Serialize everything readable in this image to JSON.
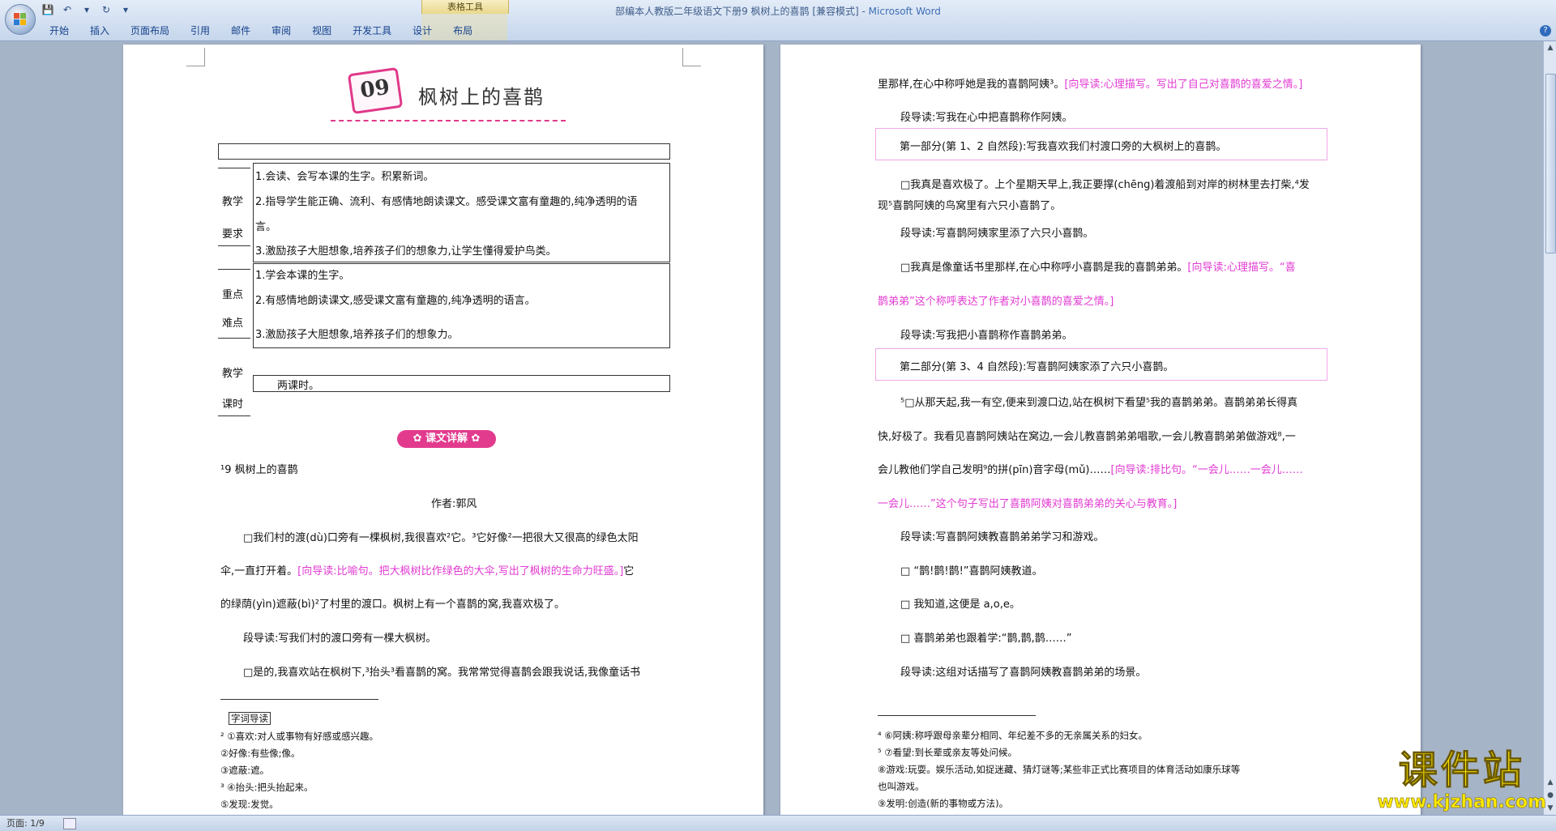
{
  "window": {
    "title": "部编本人教版二年级语文下册9 枫树上的喜鹊 [兼容模式] - ",
    "app_name": "Microsoft Word",
    "context_group": "表格工具"
  },
  "qat": {
    "save": "💾",
    "undo": "↶",
    "undo_drop": "▾",
    "redo": "↻",
    "customize": "▾"
  },
  "tabs": [
    "开始",
    "插入",
    "页面布局",
    "引用",
    "邮件",
    "审阅",
    "视图",
    "开发工具",
    "设计",
    "布局"
  ],
  "help": "?",
  "status": {
    "page": "页面: 1/9"
  },
  "left_page": {
    "badge": "09",
    "title": "枫树上的喜鹊",
    "table": {
      "req_label_1": "教学",
      "req_label_2": "要求",
      "req_1": "1.会读、会写本课的生字。积累新词。",
      "req_2a": "2.指导学生能正确、流利、有感情地朗读课文。感受课文富有童趣的,纯净透明的语",
      "req_2b": "言。",
      "req_3": "3.激励孩子大胆想象,培养孩子们的想象力,让学生懂得爱护鸟类。",
      "key_label_1": "重点",
      "key_label_2": "难点",
      "key_1": "1.学会本课的生字。",
      "key_2": "2.有感情地朗读课文,感受课文富有童趣的,纯净透明的语言。",
      "key_3": "3.激励孩子大胆想象,培养孩子们的想象力。",
      "time_label_1": "教学",
      "time_label_2": "课时",
      "time_value": "两课时。"
    },
    "section_banner": "✿ 课文详解 ✿",
    "text_title": "¹9 枫树上的喜鹊",
    "author": "作者:郭风",
    "p1a": "□我们村的渡(dù)口旁有一棵枫树,我很喜欢²它。³它好像²一把很大又很高的绿色太阳",
    "p1b_a": "伞,一直打开着。",
    "p1b_b": "[向导读:比喻句。把大枫树比作绿色的大伞,写出了枫树的生命力旺盛。]",
    "p1b_c": "它",
    "p1c": "的绿荫(yìn)遮蔽(bì)²了村里的渡口。枫树上有一个喜鹊的窝,我喜欢极了。",
    "p2": "段导读:写我们村的渡口旁有一棵大枫树。",
    "p3": "□是的,我喜欢站在枫树下,³抬头³看喜鹊的窝。我常常觉得喜鹊会跟我说话,我像童话书",
    "fn_heading": "字词导读",
    "fn_1": "² ①喜欢:对人或事物有好感或感兴趣。",
    "fn_2": "②好像:有些像;像。",
    "fn_3": "③遮蔽:遮。",
    "fn_4": "³ ④抬头:把头抬起来。",
    "fn_5": "⑤发现:发觉。"
  },
  "right_page": {
    "l1_a": "里那样,在心中称呼她是我的喜鹊阿姨³。",
    "l1_b": "[向导读:心理描写。写出了自己对喜鹊的喜爱之情。]",
    "l2": "段导读:写我在心中把喜鹊称作阿姨。",
    "l3": "第一部分(第 1、2 自然段):写我喜欢我们村渡口旁的大枫树上的喜鹊。",
    "l4a": "□我真是喜欢极了。上个星期天早上,我正要撑(chēng)着渡船到对岸的树林里去打柴,⁴发",
    "l4b": "现⁵喜鹊阿姨的鸟窝里有六只小喜鹊了。",
    "l5": "段导读:写喜鹊阿姨家里添了六只小喜鹊。",
    "l6_a": "□我真是像童话书里那样,在心中称呼小喜鹊是我的喜鹊弟弟。",
    "l6_b": "[向导读:心理描写。“喜",
    "l6c": "鹊弟弟”这个称呼表达了作者对小喜鹊的喜爱之情。]",
    "l7": "段导读:写我把小喜鹊称作喜鹊弟弟。",
    "l8": "第二部分(第 3、4 自然段):写喜鹊阿姨家添了六只小喜鹊。",
    "l9": "⁵□从那天起,我一有空,便来到渡口边,站在枫树下看望⁵我的喜鹊弟弟。喜鹊弟弟长得真",
    "l10": "快,好极了。我看见喜鹊阿姨站在窝边,一会儿教喜鹊弟弟唱歌,一会儿教喜鹊弟弟做游戏⁸,一",
    "l11_a": "会儿教他们学自己发明⁹的拼(pīn)音字母(mǔ)……",
    "l11_b": "[向导读:排比句。“一会儿……一会儿……",
    "l12": "一会儿……”这个句子写出了喜鹊阿姨对喜鹊弟弟的关心与教育。]",
    "l13": "段导读:写喜鹊阿姨教喜鹊弟弟学习和游戏。",
    "l14": "□ “鹊!鹊!鹊!”喜鹊阿姨教道。",
    "l15": "□ 我知道,这便是 a,o,e。",
    "l16": "□ 喜鹊弟弟也跟着学:“鹊,鹊,鹊……”",
    "l17": "段导读:这组对话描写了喜鹊阿姨教喜鹊弟弟的场景。",
    "fn_1": "⁴ ⑥阿姨:称呼跟母亲辈分相同、年纪差不多的无亲属关系的妇女。",
    "fn_2": "⁵ ⑦看望:到长辈或亲友等处问候。",
    "fn_3": "⑧游戏:玩耍。娱乐活动,如捉迷藏、猜灯谜等;某些非正式比赛项目的体育活动如康乐球等",
    "fn_4": "也叫游戏。",
    "fn_5": "⑨发明:创造(新的事物或方法)。"
  },
  "watermark": {
    "text": "课件站",
    "url": "www.kjzhan.com"
  },
  "colors": {
    "annotation": "#e23ad2",
    "banner": "#e23b8e",
    "watermark": "#ffea00"
  }
}
